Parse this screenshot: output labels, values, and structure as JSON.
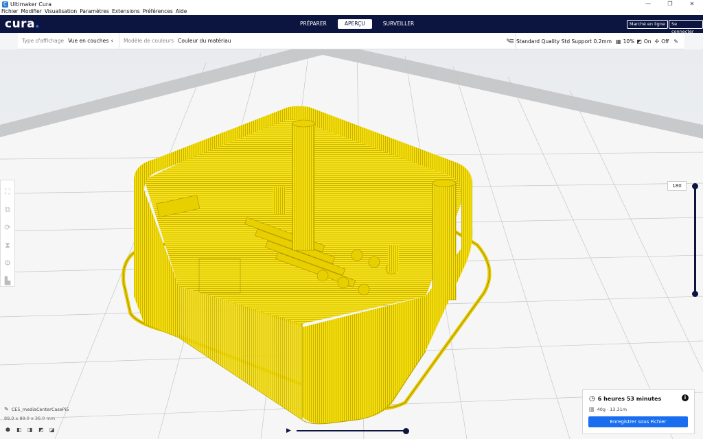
{
  "window": {
    "title": "Ultimaker Cura",
    "icon": "cura-app-icon",
    "controls": [
      "—",
      "❐",
      "✕"
    ]
  },
  "menu": [
    "Fichier",
    "Modifier",
    "Visualisation",
    "Paramètres",
    "Extensions",
    "Préférences",
    "Aide"
  ],
  "header": {
    "logo": "cura",
    "logo_dot": ".",
    "tabs": [
      {
        "label": "PRÉPARER",
        "active": false
      },
      {
        "label": "APERÇU",
        "active": true
      },
      {
        "label": "SURVEILLER",
        "active": false
      }
    ],
    "marketplace_label": "Marché en ligne",
    "signin_label": "Se connecter"
  },
  "settings_bar": {
    "view_type_label": "Type d'affichage",
    "view_type_value": "Vue en couches",
    "color_scheme_label": "Modèle de couleurs",
    "color_scheme_value": "Couleur du matériau",
    "profile": "Standard Quality Std Support 0.2mm",
    "infill": "10%",
    "support": "On",
    "adhesion": "Off"
  },
  "layer_slider": {
    "current_layer": "180"
  },
  "object": {
    "name": "CE5_mediaCenterCasePi5",
    "dimensions": "89.0 x 89.0 x 36.0 mm"
  },
  "print": {
    "time": "6 heures 53 minutes",
    "material": "40g · 13.31m",
    "save_label": "Enregistrer sous Fichier"
  },
  "colors": {
    "header": "#0c1440",
    "accent": "#196ef0",
    "filament": "#f5de0c"
  }
}
